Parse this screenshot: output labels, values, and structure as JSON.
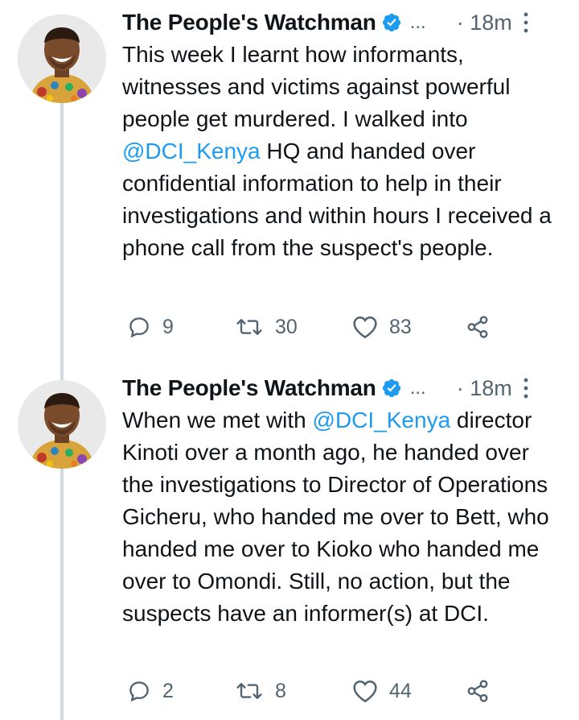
{
  "tweets": [
    {
      "author": "The People's Watchman",
      "handle": "...",
      "time": "· 18m",
      "text_before": "This week I learnt how informants, witnesses and victims against powerful people get murdered. I walked into ",
      "mention": "@DCI_Kenya",
      "text_after": " HQ and handed over confidential information to help in their investigations and within hours I received a phone call from the suspect's people.",
      "replies": "9",
      "retweets": "30",
      "likes": "83"
    },
    {
      "author": "The People's Watchman",
      "handle": "...",
      "time": "· 18m",
      "text_before": "When we met with ",
      "mention": "@DCI_Kenya",
      "text_after": " director Kinoti over a month ago, he handed over the investigations to Director of Operations Gicheru, who handed me over to Bett, who handed me over to Kioko who handed me over to Omondi. Still, no action, but the suspects have an informer(s) at DCI.",
      "replies": "2",
      "retweets": "8",
      "likes": "44"
    }
  ],
  "colors": {
    "accent": "#1d9bf0",
    "text": "#0f1419",
    "muted": "#536471",
    "thread_line": "#cfd9de"
  },
  "icons": [
    "verified-badge-icon",
    "more-options-icon",
    "reply-icon",
    "retweet-icon",
    "like-icon",
    "share-icon"
  ]
}
